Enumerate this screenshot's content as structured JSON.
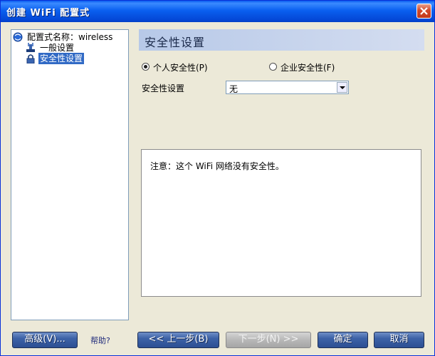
{
  "window": {
    "title": "创建 WiFi 配置式"
  },
  "tree": {
    "root_label": "配置式名称：wireless",
    "items": [
      {
        "label": "一般设置",
        "icon": "network-icon"
      },
      {
        "label": "安全性设置",
        "icon": "lock-icon",
        "selected": true
      }
    ]
  },
  "panel": {
    "title": "安全性设置",
    "radio_personal": "个人安全性(P)",
    "radio_enterprise": "企业安全性(F)",
    "selected_mode": "personal",
    "security_label": "安全性设置",
    "security_value": "无",
    "notice": "注意：这个 WiFi 网络没有安全性。"
  },
  "footer": {
    "advanced": "高级(V)...",
    "help": "帮助?",
    "back": "<< 上一步(B)",
    "next": "下一步(N) >>",
    "ok": "确定",
    "cancel": "取消"
  },
  "colors": {
    "title_bar": "#0a5bf0",
    "button": "#3d62a7",
    "selection": "#316ac5",
    "panel_head": "#b7c9e8"
  }
}
